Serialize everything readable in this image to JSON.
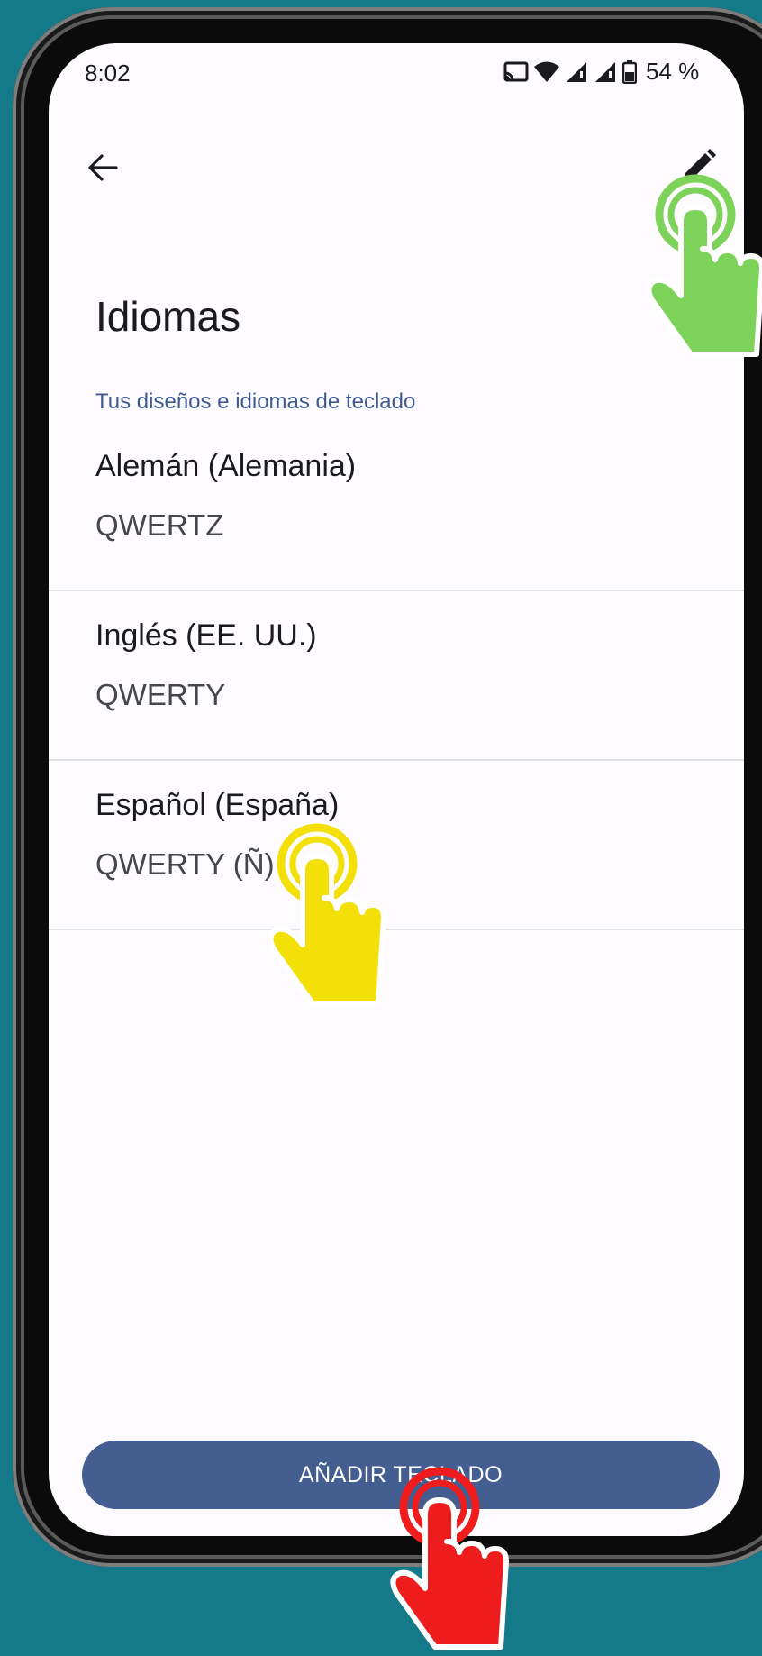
{
  "status_bar": {
    "time": "8:02",
    "battery": "54 %",
    "icons": [
      "cast-icon",
      "wifi-icon",
      "signal-icon",
      "signal-roaming-icon",
      "battery-icon"
    ]
  },
  "app_bar": {
    "back_icon": "arrow-left-icon",
    "edit_icon": "pencil-icon"
  },
  "page": {
    "title": "Idiomas",
    "section_header": "Tus diseños e idiomas de teclado"
  },
  "languages": [
    {
      "name": "Alemán (Alemania)",
      "layout": "QWERTZ"
    },
    {
      "name": "Inglés (EE. UU.)",
      "layout": "QWERTY"
    },
    {
      "name": "Español (España)",
      "layout": "QWERTY (Ñ)"
    }
  ],
  "add_button": {
    "label": "AÑADIR TECLADO"
  },
  "colors": {
    "accent": "#445e91",
    "section_header": "#3f5c92",
    "background": "#147a8a",
    "pointer_green": "#7dd35a",
    "pointer_yellow": "#f2e008",
    "pointer_red": "#ee1c1c"
  }
}
